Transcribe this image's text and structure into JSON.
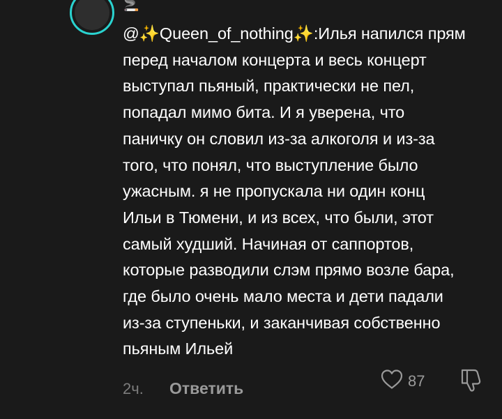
{
  "comment": {
    "username_snippet": "🚬",
    "lines": [
      "@✨Queen_of_nothing✨:Илья напился прям",
      "перед началом концерта и весь концерт",
      "выступал пьяный, практически не пел,",
      "попадал мимо бита. И я уверена, что",
      "паничку он словил из-за алкоголя и из-за",
      "того, что понял, что выступление было",
      "ужасным. я не пропускала ни один конц",
      "Ильи в Тюмени, и из всех, что были, этот",
      "самый худший. Начиная от саппортов,",
      "которые разводили слэм прямо возле бара,",
      "где было очень мало места и дети падали",
      "из-за ступеньки, и заканчивая собственно",
      "пьяным Ильей"
    ]
  },
  "meta": {
    "time": "2ч.",
    "reply_label": "Ответить",
    "likes": "87"
  },
  "icons": {
    "like": "heart-outline-icon",
    "dislike": "thumbs-down-outline-icon"
  },
  "colors": {
    "background": "#1a1a1a",
    "avatar_ring": "#2ad3d0",
    "text": "#ffffff",
    "muted": "#8a8a8a"
  }
}
